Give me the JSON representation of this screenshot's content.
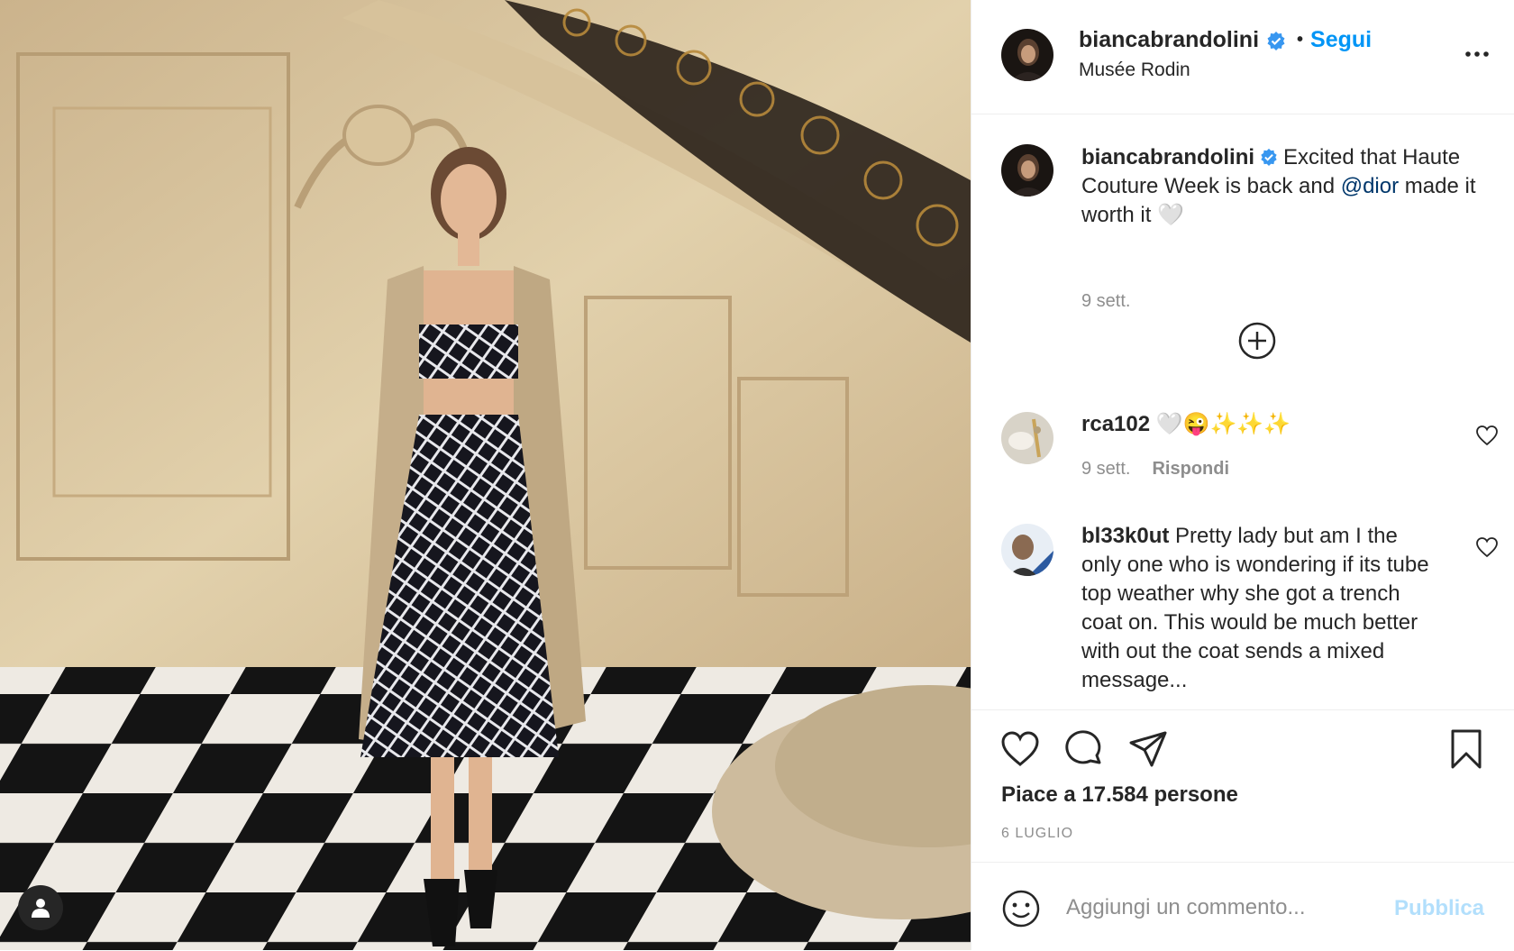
{
  "post": {
    "author": {
      "username": "biancabrandolini",
      "verified": true,
      "location": "Musée Rodin",
      "follow_label": "Segui",
      "separator": "•"
    },
    "caption": {
      "username": "biancabrandolini",
      "text_before": "Excited that Haute Couture Week is back and ",
      "mention": "@dior",
      "text_after": " made it worth it 🤍",
      "time": "9 sett."
    },
    "comments": [
      {
        "username": "rca102",
        "text": "🤍😜✨✨✨",
        "time": "9 sett.",
        "reply_label": "Rispondi"
      },
      {
        "username": "bl33k0ut",
        "text": "Pretty lady but am I the only one who is wondering if its tube top weather why she got a trench coat on. This would be much better with out the coat sends a mixed message..."
      }
    ],
    "likes_text": "Piace a 17.584 persone",
    "date": "6 LUGLIO",
    "composer": {
      "placeholder": "Aggiungi un commento...",
      "publish_label": "Pubblica"
    }
  },
  "icons": {
    "header": [
      "verified-badge-icon",
      "more-options-icon"
    ],
    "actions": [
      "heart-icon",
      "comment-icon",
      "share-icon",
      "bookmark-icon"
    ],
    "composer": [
      "emoji-icon"
    ],
    "photo": [
      "user-tag-icon"
    ],
    "comments": [
      "load-more-icon",
      "comment-like-icon"
    ]
  },
  "colors": {
    "link": "#0095f6",
    "mention": "#00376b",
    "publish_disabled": "#b2dffc",
    "muted": "#8e8e8e",
    "text": "#262626",
    "verified": "#3897f0"
  }
}
